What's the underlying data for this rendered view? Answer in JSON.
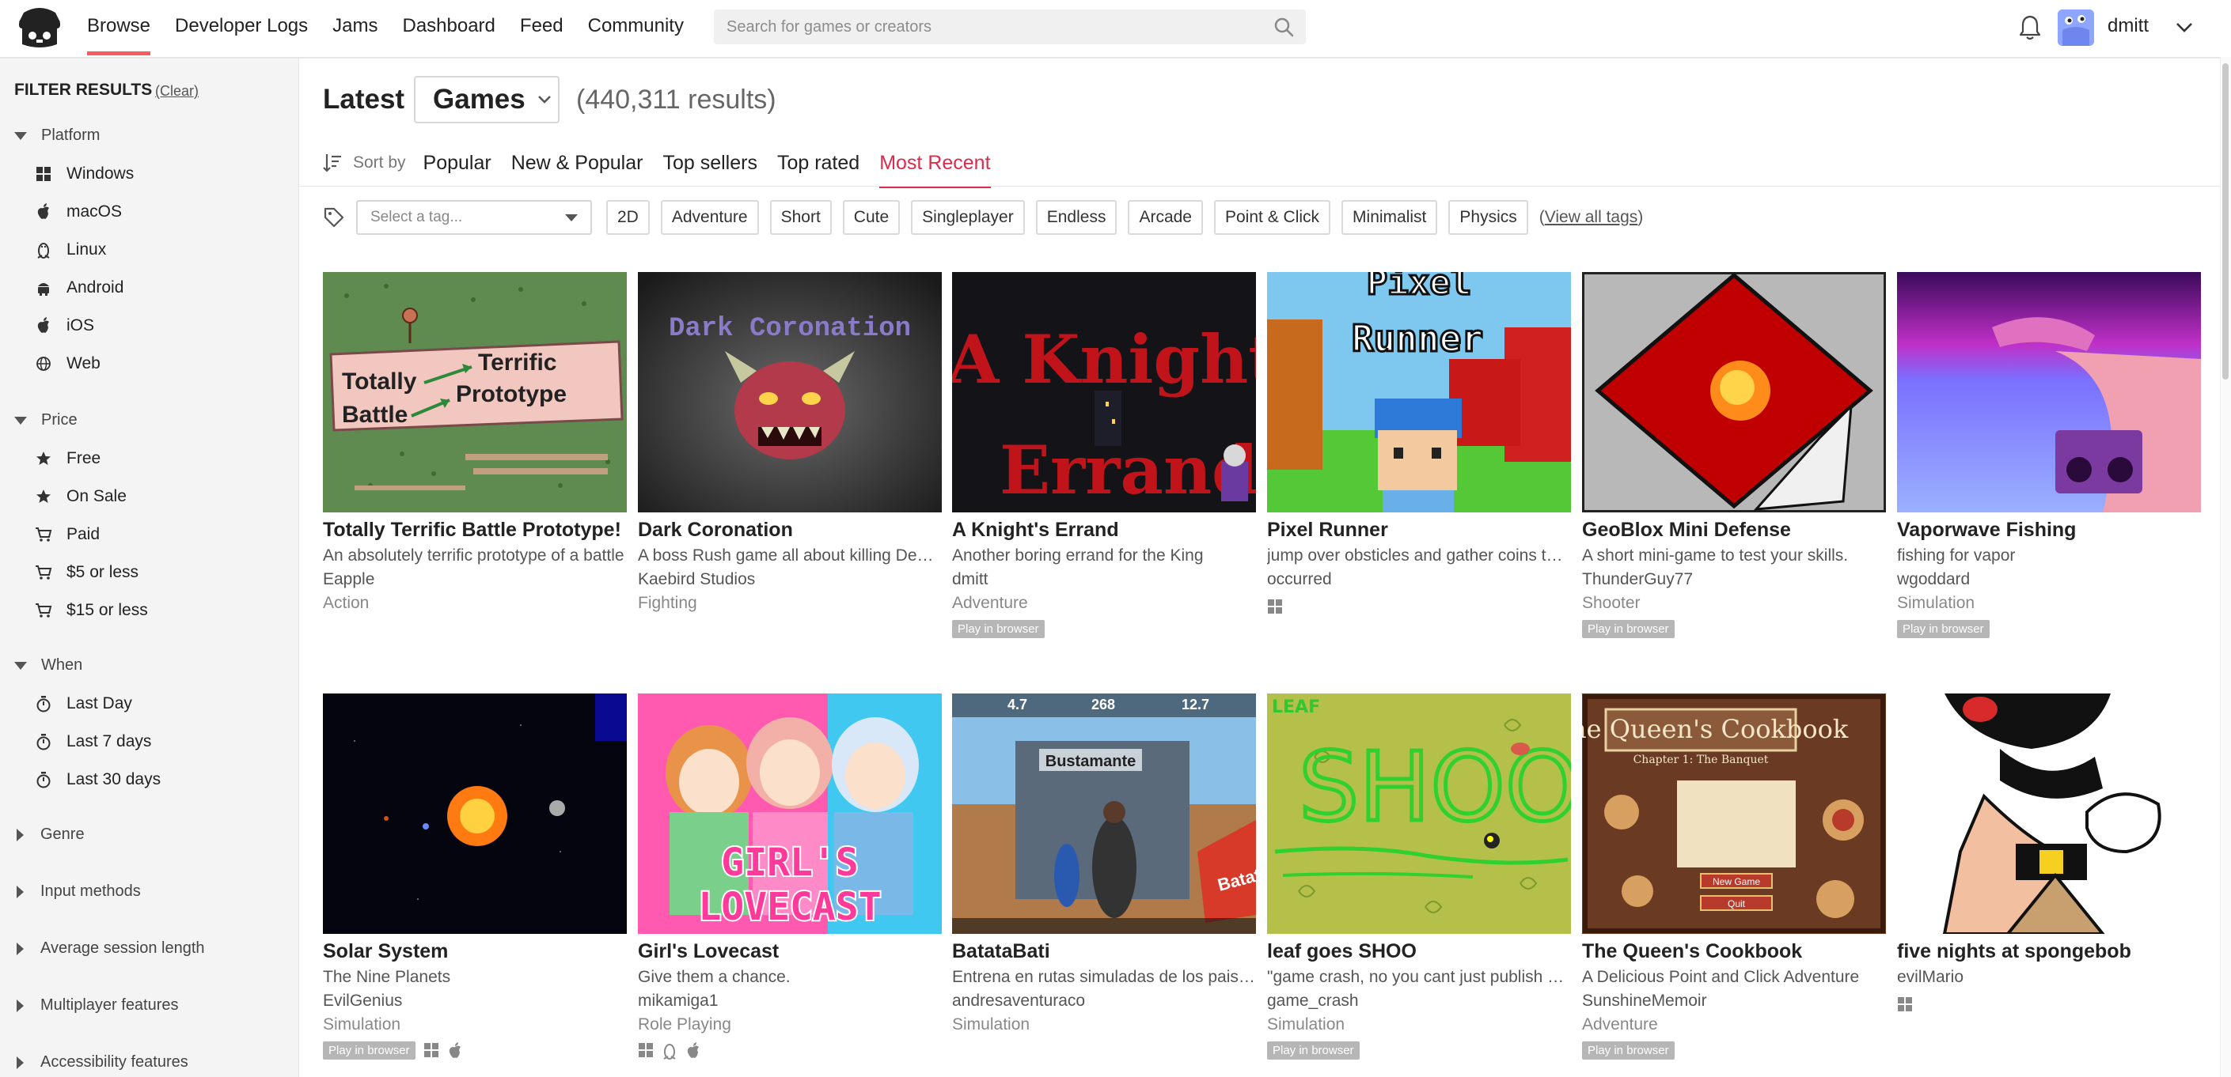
{
  "nav": {
    "items": [
      "Browse",
      "Developer Logs",
      "Jams",
      "Dashboard",
      "Feed",
      "Community"
    ],
    "active": "Browse"
  },
  "search": {
    "placeholder": "Search for games or creators"
  },
  "user": {
    "name": "dmitt"
  },
  "sidebar": {
    "title": "FILTER RESULTS",
    "clear": "(Clear)",
    "sections": {
      "platform": {
        "label": "Platform",
        "items": [
          "Windows",
          "macOS",
          "Linux",
          "Android",
          "iOS",
          "Web"
        ]
      },
      "price": {
        "label": "Price",
        "items": [
          "Free",
          "On Sale",
          "Paid",
          "$5 or less",
          "$15 or less"
        ]
      },
      "when": {
        "label": "When",
        "items": [
          "Last Day",
          "Last 7 days",
          "Last 30 days"
        ]
      },
      "collapsed": [
        "Genre",
        "Input methods",
        "Average session length",
        "Multiplayer features",
        "Accessibility features"
      ]
    }
  },
  "main": {
    "title": "Latest",
    "type_select": "Games",
    "results": "(440,311 results)",
    "sort_label": "Sort by",
    "sort_options": [
      "Popular",
      "New & Popular",
      "Top sellers",
      "Top rated",
      "Most Recent"
    ],
    "sort_active": "Most Recent",
    "tag_placeholder": "Select a tag...",
    "tags": [
      "2D",
      "Adventure",
      "Short",
      "Cute",
      "Singleplayer",
      "Endless",
      "Arcade",
      "Point & Click",
      "Minimalist",
      "Physics"
    ],
    "view_all_prefix": "(",
    "view_all": "View all tags",
    "view_all_suffix": ")"
  },
  "games": [
    {
      "title": "Totally Terrific Battle Prototype!",
      "desc": "An absolutely terrific prototype of a battle",
      "author": "Eapple",
      "genre": "Action",
      "badge": "",
      "platforms": []
    },
    {
      "title": "Dark Coronation",
      "desc": "A boss Rush game all about killing Devils!",
      "author": "Kaebird Studios",
      "genre": "Fighting",
      "badge": "",
      "platforms": []
    },
    {
      "title": "A Knight's Errand",
      "desc": "Another boring errand for the King",
      "author": "dmitt",
      "genre": "Adventure",
      "badge": "Play in browser",
      "platforms": []
    },
    {
      "title": "Pixel Runner",
      "desc": "jump over obsticles and gather coins to survive",
      "author": "occurred",
      "genre": "",
      "badge": "",
      "platforms": [
        "windows"
      ]
    },
    {
      "title": "GeoBlox Mini Defense",
      "desc": "A short mini-game to test your skills.",
      "author": "ThunderGuy77",
      "genre": "Shooter",
      "badge": "Play in browser",
      "platforms": []
    },
    {
      "title": "Vaporwave Fishing",
      "desc": "fishing for vapor",
      "author": "wgoddard",
      "genre": "Simulation",
      "badge": "Play in browser",
      "platforms": []
    },
    {
      "title": "Solar System",
      "desc": "The Nine Planets",
      "author": "EvilGenius",
      "genre": "Simulation",
      "badge": "Play in browser",
      "platforms": [
        "windows",
        "macos"
      ]
    },
    {
      "title": "Girl's Lovecast",
      "desc": "Give them a chance.",
      "author": "mikamiga1",
      "genre": "Role Playing",
      "badge": "",
      "platforms": [
        "windows",
        "linux",
        "macos"
      ]
    },
    {
      "title": "BatataBati",
      "desc": "Entrena en rutas simuladas de los paisajes de Bolivia",
      "author": "andresaventuraco",
      "genre": "Simulation",
      "badge": "",
      "platforms": []
    },
    {
      "title": "leaf goes SHOO",
      "desc": "\"game crash, no you cant just publish an unfinished game\"",
      "author": "game_crash",
      "genre": "Simulation",
      "badge": "Play in browser",
      "platforms": []
    },
    {
      "title": "The Queen's Cookbook",
      "desc": "A Delicious Point and Click Adventure",
      "author": "SunshineMemoir",
      "genre": "Adventure",
      "badge": "Play in browser",
      "platforms": []
    },
    {
      "title": "five nights at spongebob",
      "desc": "evilMario",
      "author": "",
      "genre": "",
      "badge": "",
      "platforms": [
        "windows"
      ]
    }
  ],
  "thumb_text": {
    "ttbp_line1a": "Totally",
    "ttbp_line1b": "Terrific",
    "ttbp_line2a": "Battle",
    "ttbp_line2b": "Prototype",
    "dark": "Dark Coronation",
    "knight1": "A Knight'",
    "knight2": "Errand",
    "pixel1": "Pixel",
    "pixel2": "Runner",
    "bata_hud1": "4.7",
    "bata_hud2": "268",
    "bata_hud3": "12.7",
    "bata_name": "Bustamante",
    "bata_brand": "Batat",
    "girls1": "GIRL'S",
    "girls2": "LOVECAST",
    "leaf": "SHOO",
    "leaf_small": "LEAF",
    "queen_title": "The Queen's Cookbook",
    "queen_sub": "Chapter 1: The Banquet",
    "queen_btn1": "New Game",
    "queen_btn2": "Quit"
  }
}
